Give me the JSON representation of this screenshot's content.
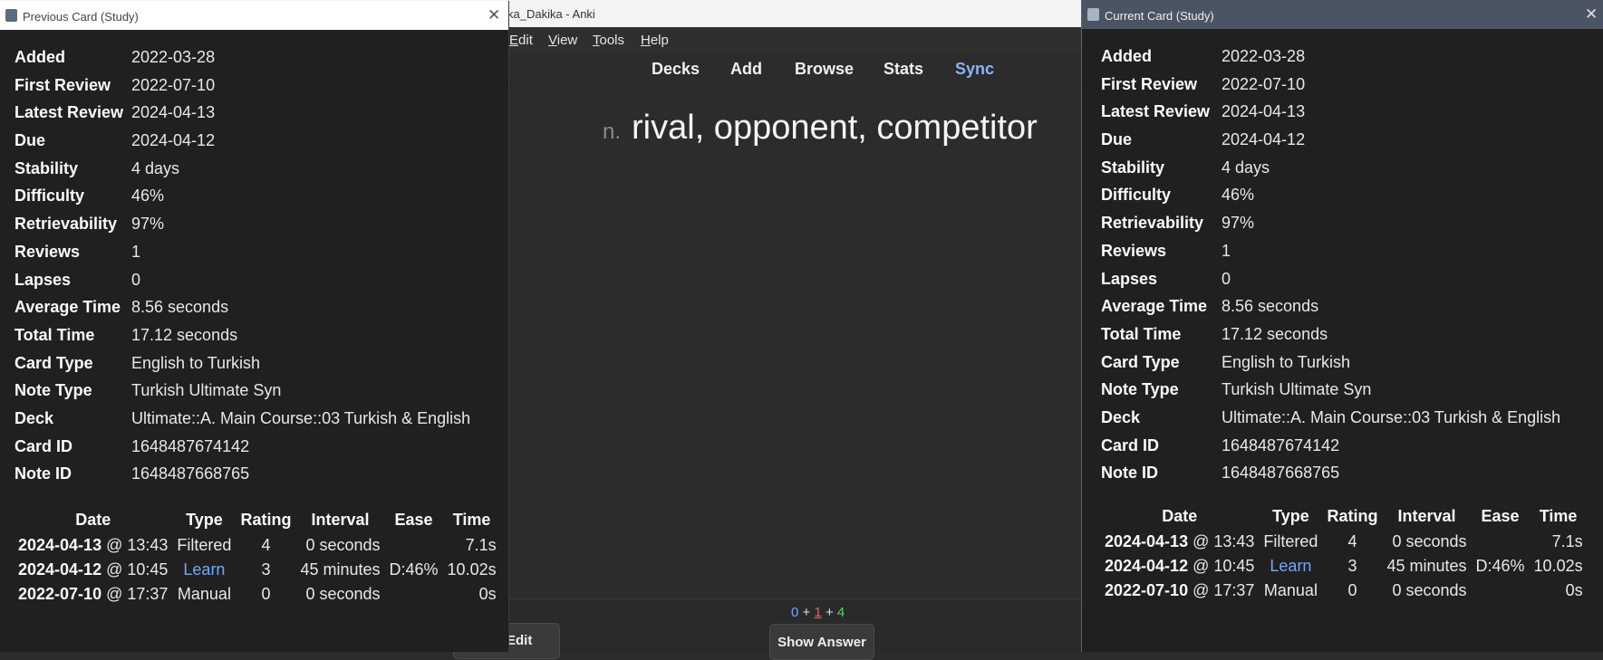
{
  "main": {
    "window_title": "ka_Dakika - Anki",
    "menu": [
      {
        "accel": "E",
        "rest": "dit"
      },
      {
        "accel": "V",
        "rest": "iew"
      },
      {
        "accel": "T",
        "rest": "ools"
      },
      {
        "accel": "H",
        "rest": "elp"
      }
    ],
    "toolbar": [
      "Decks",
      "Add",
      "Browse",
      "Stats",
      "Sync"
    ],
    "card": {
      "pos": "n.",
      "text": "rival, opponent, competitor"
    },
    "counts": {
      "new": "0",
      "learn": "1",
      "review": "4",
      "plus": "+"
    },
    "edit_label": "Edit",
    "show_answer_label": "Show Answer"
  },
  "prev_window": {
    "title": "Previous Card (Study)",
    "close": "✕",
    "stats": [
      {
        "label": "Added",
        "value": "2022-03-28"
      },
      {
        "label": "First Review",
        "value": "2022-07-10"
      },
      {
        "label": "Latest Review",
        "value": "2024-04-13"
      },
      {
        "label": "Due",
        "value": "2024-04-12"
      },
      {
        "label": "Stability",
        "value": "4 days"
      },
      {
        "label": "Difficulty",
        "value": "46%"
      },
      {
        "label": "Retrievability",
        "value": "97%"
      },
      {
        "label": "Reviews",
        "value": "1"
      },
      {
        "label": "Lapses",
        "value": "0"
      },
      {
        "label": "Average Time",
        "value": "8.56 seconds"
      },
      {
        "label": "Total Time",
        "value": "17.12 seconds"
      },
      {
        "label": "Card Type",
        "value": "English to Turkish"
      },
      {
        "label": "Note Type",
        "value": "Turkish Ultimate Syn"
      },
      {
        "label": "Deck",
        "value": "Ultimate::A. Main Course::03 Turkish & English"
      },
      {
        "label": "Card ID",
        "value": "1648487674142"
      },
      {
        "label": "Note ID",
        "value": "1648487668765"
      }
    ],
    "revlog_headers": [
      "Date",
      "Type",
      "Rating",
      "Interval",
      "Ease",
      "Time"
    ],
    "revlog_rows": [
      {
        "date": "2024-04-13",
        "time_of_day": "@ 13:43",
        "type": "Filtered",
        "rating": "4",
        "interval": "0 seconds",
        "ease": "",
        "time": "7.1s"
      },
      {
        "date": "2024-04-12",
        "time_of_day": "@ 10:45",
        "type": "Learn",
        "rating": "3",
        "interval": "45 minutes",
        "ease": "D:46%",
        "time": "10.02s"
      },
      {
        "date": "2022-07-10",
        "time_of_day": "@ 17:37",
        "type": "Manual",
        "rating": "0",
        "interval": "0 seconds",
        "ease": "",
        "time": "0s"
      }
    ]
  },
  "curr_window": {
    "title": "Current Card (Study)",
    "close": "✕",
    "stats": [
      {
        "label": "Added",
        "value": "2022-03-28"
      },
      {
        "label": "First Review",
        "value": "2022-07-10"
      },
      {
        "label": "Latest Review",
        "value": "2024-04-13"
      },
      {
        "label": "Due",
        "value": "2024-04-12"
      },
      {
        "label": "Stability",
        "value": "4 days"
      },
      {
        "label": "Difficulty",
        "value": "46%"
      },
      {
        "label": "Retrievability",
        "value": "97%"
      },
      {
        "label": "Reviews",
        "value": "1"
      },
      {
        "label": "Lapses",
        "value": "0"
      },
      {
        "label": "Average Time",
        "value": "8.56 seconds"
      },
      {
        "label": "Total Time",
        "value": "17.12 seconds"
      },
      {
        "label": "Card Type",
        "value": "English to Turkish"
      },
      {
        "label": "Note Type",
        "value": "Turkish Ultimate Syn"
      },
      {
        "label": "Deck",
        "value": "Ultimate::A. Main Course::03 Turkish & English"
      },
      {
        "label": "Card ID",
        "value": "1648487674142"
      },
      {
        "label": "Note ID",
        "value": "1648487668765"
      }
    ],
    "revlog_headers": [
      "Date",
      "Type",
      "Rating",
      "Interval",
      "Ease",
      "Time"
    ],
    "revlog_rows": [
      {
        "date": "2024-04-13",
        "time_of_day": "@ 13:43",
        "type": "Filtered",
        "rating": "4",
        "interval": "0 seconds",
        "ease": "",
        "time": "7.1s"
      },
      {
        "date": "2024-04-12",
        "time_of_day": "@ 10:45",
        "type": "Learn",
        "rating": "3",
        "interval": "45 minutes",
        "ease": "D:46%",
        "time": "10.02s"
      },
      {
        "date": "2022-07-10",
        "time_of_day": "@ 17:37",
        "type": "Manual",
        "rating": "0",
        "interval": "0 seconds",
        "ease": "",
        "time": "0s"
      }
    ]
  },
  "colors": {
    "link_blue": "#8ab4f8",
    "learn_blue": "#6fa8ff",
    "learn_red": "#e06666",
    "review_green": "#5fd36a"
  }
}
